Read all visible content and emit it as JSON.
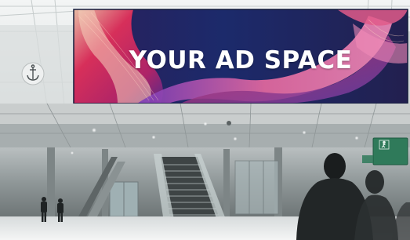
{
  "billboard": {
    "headline": "YOUR AD SPACE"
  },
  "wall_sign": {
    "icon": "anchor-icon"
  },
  "exit_sign": {
    "icon": "running-figure-icon",
    "caption": ""
  },
  "colors": {
    "billboard_background": "#1c2a6b",
    "ribbon_red": "#e0305a",
    "ribbon_pink": "#e86aa0",
    "ribbon_purple": "#7a3db8",
    "exit_sign_green": "#2f7a5a",
    "ceiling_grey": "#cfd3d3"
  }
}
